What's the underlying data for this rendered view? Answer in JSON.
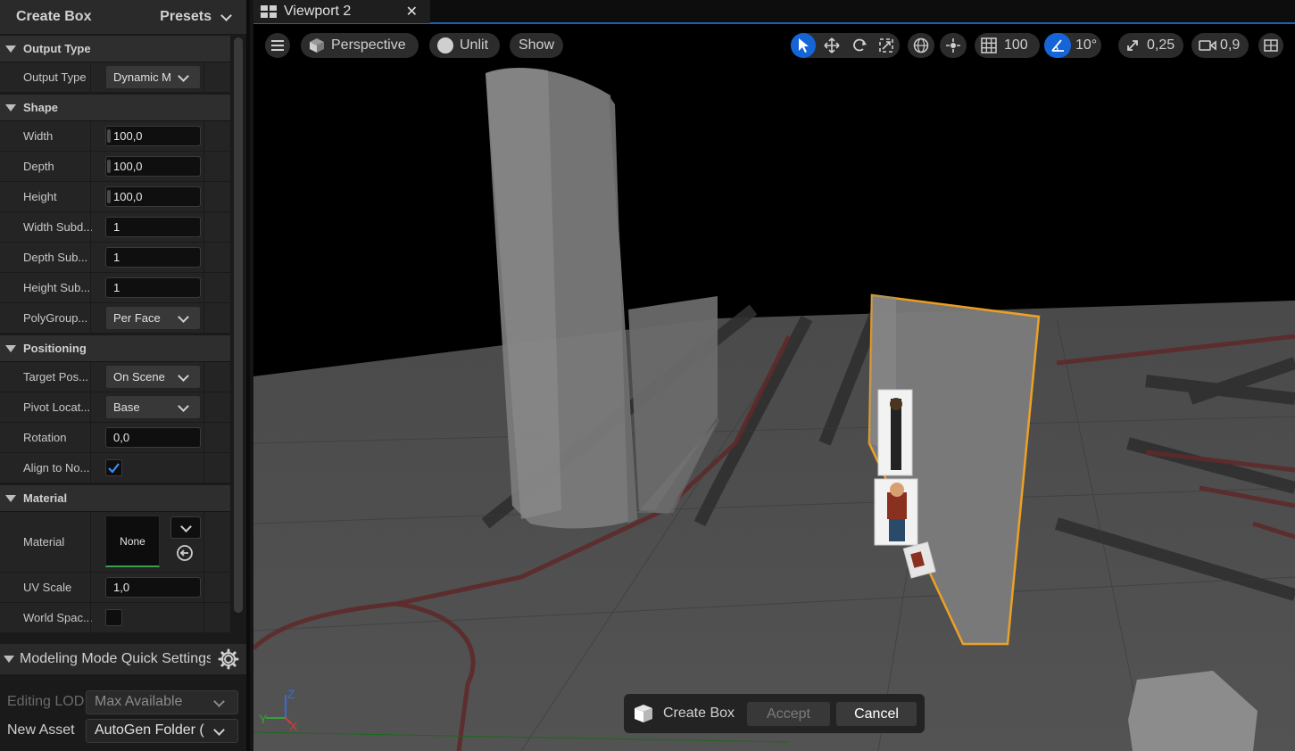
{
  "left_panel": {
    "title": "Create Box",
    "presets_label": "Presets",
    "sections": {
      "output_type": "Output Type",
      "shape": "Shape",
      "positioning": "Positioning",
      "material": "Material"
    },
    "fields": {
      "output_type": {
        "label": "Output Type",
        "value": "Dynamic M"
      },
      "width": {
        "label": "Width",
        "value": "100,0"
      },
      "depth": {
        "label": "Depth",
        "value": "100,0"
      },
      "height": {
        "label": "Height",
        "value": "100,0"
      },
      "width_subdiv": {
        "label": "Width Subd...",
        "value": "1"
      },
      "depth_subdiv": {
        "label": "Depth Sub...",
        "value": "1"
      },
      "height_subdiv": {
        "label": "Height Sub...",
        "value": "1"
      },
      "polygroup": {
        "label": "PolyGroup...",
        "value": "Per Face"
      },
      "target_pos": {
        "label": "Target Pos...",
        "value": "On Scene"
      },
      "pivot_loc": {
        "label": "Pivot Locat...",
        "value": "Base"
      },
      "rotation": {
        "label": "Rotation",
        "value": "0,0"
      },
      "align_normal": {
        "label": "Align to No...",
        "checked": true
      },
      "material": {
        "label": "Material",
        "value": "None"
      },
      "uv_scale": {
        "label": "UV Scale",
        "value": "1,0"
      },
      "world_space": {
        "label": "World Spac...",
        "checked": false
      }
    }
  },
  "quick_settings": {
    "title": "Modeling Mode Quick Settings",
    "editing_lod": {
      "label": "Editing LOD",
      "value": "Max Available"
    },
    "new_asset": {
      "label": "New Asset",
      "value": "AutoGen Folder ("
    }
  },
  "viewport": {
    "tab_title": "Viewport 2",
    "close_glyph": "✕",
    "view_mode": "Perspective",
    "lit_mode": "Unlit",
    "show_label": "Show",
    "grid_snap": "100",
    "rotation_snap": "10°",
    "scale_snap": "0,25",
    "camera_speed": "0,9",
    "axis_labels": {
      "z": "Z",
      "y": "Y",
      "x": "X"
    },
    "accent_color": "#1565d8",
    "selection_color": "#f5a623"
  },
  "create_bar": {
    "label": "Create Box",
    "accept": "Accept",
    "cancel": "Cancel"
  }
}
